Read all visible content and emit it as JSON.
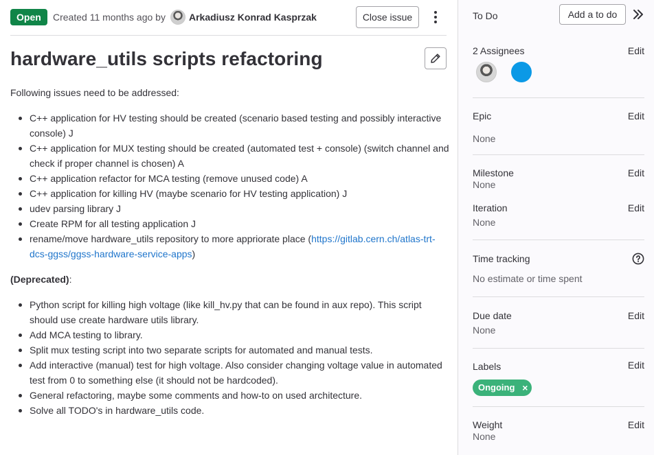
{
  "issue": {
    "status": "Open",
    "created_text": "Created 11 months ago by",
    "author": "Arkadiusz Konrad Kasprzak",
    "close_button": "Close issue",
    "title": "hardware_utils scripts refactoring",
    "intro": "Following issues need to be addressed:",
    "tasks": [
      "C++ application for HV testing should be created (scenario based testing and possibly interactive console) J",
      "C++ application for MUX testing should be created (automated test + console) (switch channel and check if proper channel is chosen) A",
      "C++ application refactor for MCA testing (remove unused code) A",
      "C++ application for killing HV (maybe scenario for HV testing application) J",
      "udev parsing library J",
      "Create RPM for all testing application J"
    ],
    "task_last_prefix": "rename/move hardware_utils repository to more appriorate place (",
    "task_last_link": "https://gitlab.cern.ch/atlas-trt-dcs-ggss/ggss-hardware-service-apps",
    "task_last_suffix": ")",
    "deprecated_label": "(Deprecated)",
    "deprecated_colon": ":",
    "deprecated_items": [
      "Python script for killing high voltage (like kill_hv.py that can be found in aux repo). This script should use create hardware utils library.",
      "Add MCA testing to library.",
      "Split mux testing script into two separate scripts for automated and manual tests.",
      "Add interactive (manual) test for high voltage. Also consider changing voltage value in automated test from 0 to something else (it should not be hardcoded).",
      "General refactoring, maybe some comments and how-to on used architecture.",
      "Solve all TODO's in hardware_utils code."
    ]
  },
  "sidebar": {
    "todo_label": "To Do",
    "todo_button": "Add a to do",
    "assignees_label": "2 Assignees",
    "edit": "Edit",
    "epic_label": "Epic",
    "epic_value": "None",
    "milestone_label": "Milestone",
    "milestone_value": "None",
    "iteration_label": "Iteration",
    "iteration_value": "None",
    "time_label": "Time tracking",
    "time_value": "No estimate or time spent",
    "due_label": "Due date",
    "due_value": "None",
    "labels_label": "Labels",
    "label_chip": "Ongoing",
    "label_remove": "×",
    "weight_label": "Weight",
    "weight_value": "None"
  },
  "colors": {
    "open_badge": "#108548",
    "link": "#1f75cb",
    "label_ongoing": "#3bb27a",
    "assignee_blue": "#0b99e6"
  },
  "icons": [
    "kebab-menu-icon",
    "pencil-icon",
    "double-chevron-right-icon",
    "question-circle-icon",
    "close-icon"
  ]
}
